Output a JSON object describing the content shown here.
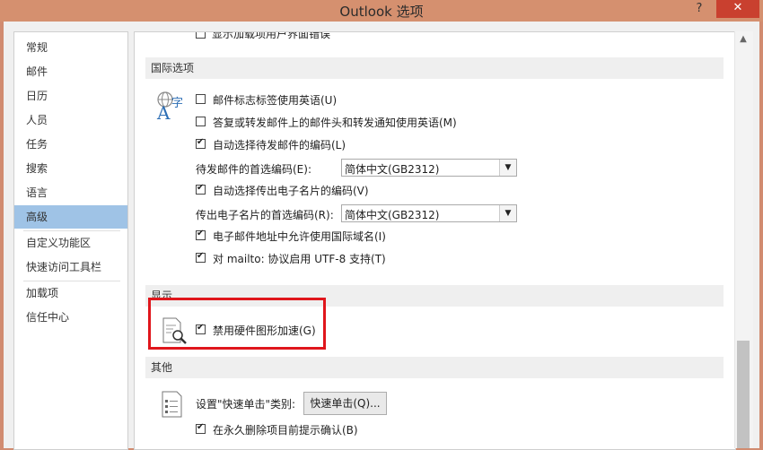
{
  "window": {
    "title": "Outlook 选项",
    "help_glyph": "?",
    "close_glyph": "✕"
  },
  "sidebar": {
    "items": [
      {
        "label": "常规"
      },
      {
        "label": "邮件"
      },
      {
        "label": "日历"
      },
      {
        "label": "人员"
      },
      {
        "label": "任务"
      },
      {
        "label": "搜索"
      },
      {
        "label": "语言"
      },
      {
        "label": "高级",
        "active": true
      },
      {
        "label": "自定义功能区"
      },
      {
        "label": "快速访问工具栏"
      },
      {
        "label": "加载项"
      },
      {
        "label": "信任中心"
      }
    ]
  },
  "content": {
    "top_partial": {
      "label": "显示加载项用户界面错误",
      "checked": false
    },
    "international": {
      "header": "国际选项",
      "options": [
        {
          "label": "邮件标志标签使用英语(U)",
          "checked": false
        },
        {
          "label": "答复或转发邮件上的邮件头和转发通知使用英语(M)",
          "checked": false
        },
        {
          "label": "自动选择待发邮件的编码(L)",
          "checked": true
        }
      ],
      "outgoing_encoding": {
        "label": "待发邮件的首选编码(E):",
        "value": "简体中文(GB2312)"
      },
      "vcard_auto": {
        "label": "自动选择传出电子名片的编码(V)",
        "checked": true
      },
      "vcard_encoding": {
        "label": "传出电子名片的首选编码(R):",
        "value": "简体中文(GB2312)"
      },
      "idn": {
        "label": "电子邮件地址中允许使用国际域名(I)",
        "checked": true
      },
      "mailto_utf8": {
        "label": "对 mailto: 协议启用 UTF-8 支持(T)",
        "checked": true
      }
    },
    "display": {
      "header": "显示",
      "hw_accel": {
        "label": "禁用硬件图形加速(G)",
        "checked": true
      }
    },
    "other": {
      "header": "其他",
      "quick_click_label": "设置\"快速单击\"类别:",
      "quick_click_button": "快速单击(Q)...",
      "confirm_delete": {
        "label": "在永久删除项目前提示确认(B)",
        "checked": true
      }
    }
  },
  "colors": {
    "highlight_box": "#e0161c",
    "active_item": "#9fc3e6",
    "titlebar": "#d5906f"
  }
}
